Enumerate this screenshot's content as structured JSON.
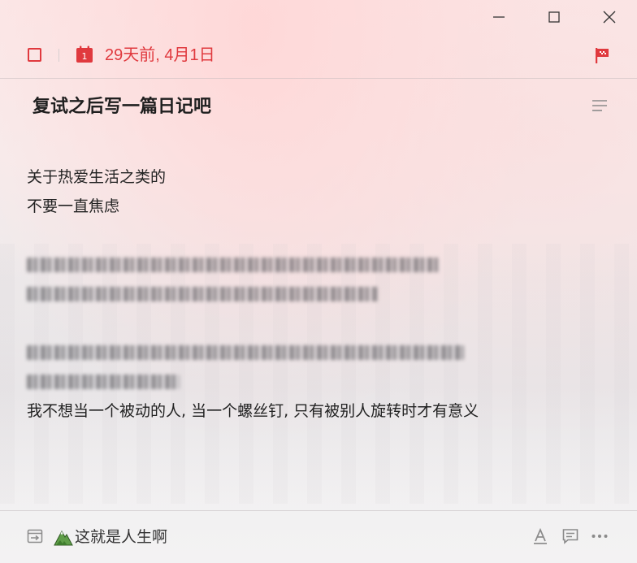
{
  "window": {
    "minimize_icon": "minimize-icon",
    "maximize_icon": "maximize-icon",
    "close_icon": "close-icon"
  },
  "toolbar": {
    "calendar_day": "1",
    "date_label": "29天前, 4月1日",
    "accent_color": "#e0393e"
  },
  "task": {
    "title": "复试之后写一篇日记吧",
    "lines": [
      "关于热爱生活之类的",
      "不要一直焦虑"
    ],
    "last_line": "我不想当一个被动的人, 当一个螺丝钉, 只有被别人旋转时才有意义"
  },
  "footer": {
    "project_label": "这就是人生啊"
  }
}
